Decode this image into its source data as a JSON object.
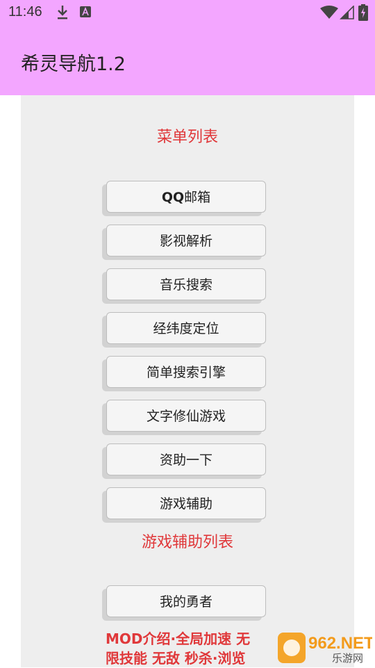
{
  "status_bar": {
    "time": "11:46"
  },
  "app_bar": {
    "title": "希灵导航1.2"
  },
  "menu": {
    "title": "菜单列表",
    "buttons": [
      {
        "label_bold": "QQ",
        "label": "邮箱"
      },
      {
        "label": "影视解析"
      },
      {
        "label": "音乐搜索"
      },
      {
        "label": "经纬度定位"
      },
      {
        "label": "简单搜索引擎"
      },
      {
        "label": "文字修仙游戏"
      },
      {
        "label": "资助一下"
      },
      {
        "label": "游戏辅助"
      }
    ]
  },
  "game_assist": {
    "title": "游戏辅助列表",
    "buttons": [
      {
        "label": "我的勇者"
      }
    ],
    "description_line1": "MOD介绍·全局加速 无",
    "description_line2": "限技能 无敌 秒杀·浏览"
  },
  "watermark": {
    "text": "962.NET",
    "subtext": "乐游网"
  },
  "colors": {
    "app_bar": "#f3a6ff",
    "accent_text": "#e0383a",
    "panel": "#eeeeee"
  }
}
